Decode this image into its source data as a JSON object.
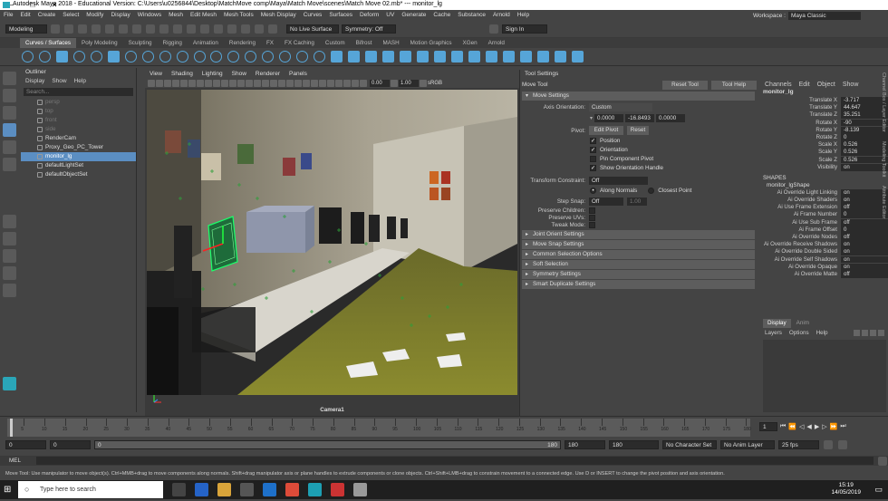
{
  "titlebar": {
    "title": "Autodesk Maya 2018 - Educational Version: C:\\Users\\u0256844\\Desktop\\MatchMove comp\\Maya\\Match Move\\scenes\\Match Move 02.mb* --- monitor_lg"
  },
  "menu": [
    "File",
    "Edit",
    "Create",
    "Select",
    "Modify",
    "Display",
    "Windows",
    "Mesh",
    "Edit Mesh",
    "Mesh Tools",
    "Mesh Display",
    "Curves",
    "Surfaces",
    "Deform",
    "UV",
    "Generate",
    "Cache",
    "Substance",
    "Arnold",
    "Help"
  ],
  "workspace": {
    "label": "Workspace :",
    "value": "Maya Classic"
  },
  "status": {
    "mode": "Modeling",
    "live": "No Live Surface",
    "symmetry": "Symmetry: Off",
    "signin": "Sign In"
  },
  "shelf_tabs": [
    "Curves / Surfaces",
    "Poly Modeling",
    "Sculpting",
    "Rigging",
    "Animation",
    "Rendering",
    "FX",
    "FX Caching",
    "Custom",
    "Bifrost",
    "MASH",
    "Motion Graphics",
    "XGen",
    "Arnold"
  ],
  "outliner": {
    "title": "Outliner",
    "menu": [
      "Display",
      "Show",
      "Help"
    ],
    "search_placeholder": "Search...",
    "items": [
      {
        "label": "persp",
        "state": "dim"
      },
      {
        "label": "top",
        "state": "dim"
      },
      {
        "label": "front",
        "state": "dim"
      },
      {
        "label": "side",
        "state": "dim"
      },
      {
        "label": "RenderCam",
        "state": "normal"
      },
      {
        "label": "Proxy_Geo_PC_Tower",
        "state": "normal"
      },
      {
        "label": "monitor_lg",
        "state": "selected"
      },
      {
        "label": "defaultLightSet",
        "state": "normal"
      },
      {
        "label": "defaultObjectSet",
        "state": "normal"
      }
    ]
  },
  "viewport": {
    "menu": [
      "View",
      "Shading",
      "Lighting",
      "Show",
      "Renderer",
      "Panels"
    ],
    "near": "0.00",
    "far": "1.00",
    "color": "sRGB",
    "camera": "Camera1"
  },
  "toolsettings": {
    "title": "Tool Settings",
    "tool": "Move Tool",
    "reset": "Reset Tool",
    "help": "Tool Help",
    "move_settings": "Move Settings",
    "axis_label": "Axis Orientation:",
    "axis_value": "Custom",
    "v1": "0.0000",
    "v2": "-16.8493",
    "v3": "0.0000",
    "pivot_label": "Pivot:",
    "edit_pivot": "Edit Pivot",
    "pivot_reset": "Reset",
    "pivot_checks": [
      {
        "label": "Position",
        "checked": true
      },
      {
        "label": "Orientation",
        "checked": true
      },
      {
        "label": "Pin Component Pivot",
        "checked": false
      },
      {
        "label": "Show Orientation Handle",
        "checked": true
      }
    ],
    "transform_label": "Transform Constraint:",
    "transform_value": "Off",
    "along_normals": "Along Normals",
    "closest_point": "Closest Point",
    "step_label": "Step Snap:",
    "step_value": "Off",
    "step_num": "1.00",
    "preserve_children": "Preserve Children:",
    "preserve_uvs": "Preserve UVs:",
    "tweak_mode": "Tweak Mode:",
    "sections": [
      "Joint Orient Settings",
      "Move Snap Settings",
      "Common Selection Options",
      "Soft Selection",
      "Symmetry Settings",
      "Smart Duplicate Settings"
    ]
  },
  "channelbox": {
    "menu": [
      "Channels",
      "Edit",
      "Object",
      "Show"
    ],
    "object": "monitor_lg",
    "attrs": [
      {
        "n": "Translate X",
        "v": "-3.717"
      },
      {
        "n": "Translate Y",
        "v": "44.647"
      },
      {
        "n": "Translate Z",
        "v": "35.251"
      },
      {
        "n": "Rotate X",
        "v": "-90"
      },
      {
        "n": "Rotate Y",
        "v": "-8.139"
      },
      {
        "n": "Rotate Z",
        "v": "0"
      },
      {
        "n": "Scale X",
        "v": "0.526"
      },
      {
        "n": "Scale Y",
        "v": "0.526"
      },
      {
        "n": "Scale Z",
        "v": "0.526"
      },
      {
        "n": "Visibility",
        "v": "on"
      }
    ],
    "shapes_title": "SHAPES",
    "shape": "monitor_lgShape",
    "shape_attrs": [
      {
        "n": "Ai Override Light Linking",
        "v": "on"
      },
      {
        "n": "Ai Override Shaders",
        "v": "on"
      },
      {
        "n": "Ai Use Frame Extension",
        "v": "off"
      },
      {
        "n": "Ai Frame Number",
        "v": "0"
      },
      {
        "n": "Ai Use Sub Frame",
        "v": "off"
      },
      {
        "n": "Ai Frame Offset",
        "v": "0"
      },
      {
        "n": "Ai Override Nodes",
        "v": "off"
      },
      {
        "n": "Ai Override Receive Shadows",
        "v": "on"
      },
      {
        "n": "Ai Override Double Sided",
        "v": "on"
      },
      {
        "n": "Ai Override Self Shadows",
        "v": "on"
      },
      {
        "n": "Ai Override Opaque",
        "v": "on"
      },
      {
        "n": "Ai Override Matte",
        "v": "off"
      }
    ],
    "side_tabs": [
      "Channel Box / Layer Editor",
      "Modeling Toolkit",
      "Attribute Editor"
    ]
  },
  "layers": {
    "tabs": [
      "Display",
      "Anim"
    ],
    "menu": [
      "Layers",
      "Options",
      "Help"
    ]
  },
  "timeline": {
    "ticks": [
      "5",
      "10",
      "15",
      "20",
      "25",
      "30",
      "35",
      "40",
      "45",
      "50",
      "55",
      "60",
      "65",
      "70",
      "75",
      "80",
      "85",
      "90",
      "95",
      "100",
      "105",
      "110",
      "115",
      "120",
      "125",
      "130",
      "135",
      "140",
      "145",
      "150",
      "155",
      "160",
      "165",
      "170",
      "175",
      "180"
    ],
    "current": "1"
  },
  "range": {
    "start": "0",
    "start2": "0",
    "slider_start": "0",
    "slider_end": "180",
    "end": "180",
    "end2": "180",
    "char_set": "No Character Set",
    "anim_layer": "No Anim Layer",
    "fps": "25 fps"
  },
  "mel": {
    "label": "MEL"
  },
  "help_line": "Move Tool: Use manipulator to move object(s). Ctrl+MMB+drag to move components along normals. Shift+drag manipulator axis or plane handles to extrude components or clone objects. Ctrl+Shift+LMB+drag to constrain movement to a connected edge. Use D or INSERT to change the pivot position and axis orientation.",
  "taskbar": {
    "search": "Type here to search",
    "time": "15:19",
    "date": "14/05/2019"
  }
}
